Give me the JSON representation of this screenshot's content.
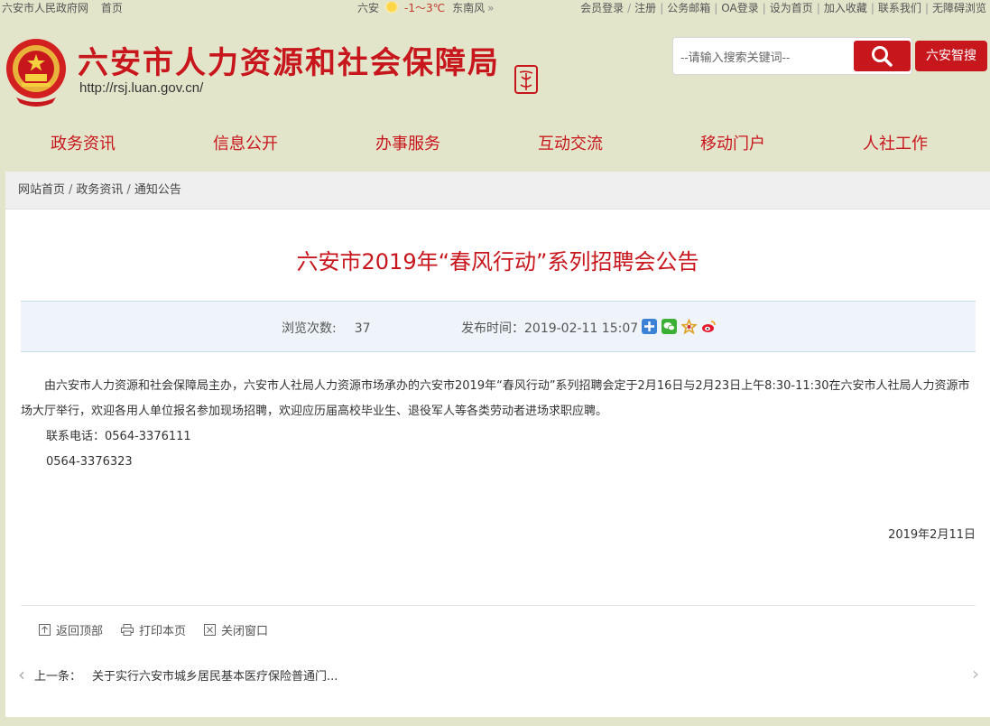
{
  "topbar": {
    "gov_site": "六安市人民政府网",
    "home": "首页",
    "city": "六安",
    "temp": "-1～3℃",
    "wind": "东南风",
    "chevron": "»",
    "links": [
      "会员登录",
      "注册",
      "公务邮箱",
      "OA登录",
      "设为首页",
      "加入收藏",
      "联系我们",
      "无障碍浏览"
    ]
  },
  "header": {
    "title": "六安市人力资源和社会保障局",
    "url": "http://rsj.luan.gov.cn/",
    "search_placeholder": "--请输入搜索关键词--",
    "smart_search": "六安智搜"
  },
  "nav": {
    "items": [
      "政务资讯",
      "信息公开",
      "办事服务",
      "互动交流",
      "移动门户",
      "人社工作"
    ]
  },
  "breadcrumb": {
    "items": [
      "网站首页",
      "政务资讯",
      "通知公告"
    ],
    "separator": "/"
  },
  "article": {
    "title": "六安市2019年“春风行动”系列招聘会公告",
    "views_label": "浏览次数:",
    "views": "37",
    "date_label": "发布时间：",
    "date": "2019-02-11 15:07",
    "paragraph": "由六安市人力资源和社会保障局主办，六安市人社局人力资源市场承办的六安市2019年“春风行动”系列招聘会定于2月16日与2月23日上午8:30-11:30在六安市人社局人力资源市场大厅举行，欢迎各用人单位报名参加现场招聘，欢迎应历届高校毕业生、退役军人等各类劳动者进场求职应聘。",
    "contact_label": "联系电话：",
    "phone1": "0564-3376111",
    "phone2": "0564-3376323",
    "sign_date": "2019年2月11日"
  },
  "tools": {
    "back_top": "返回顶部",
    "print": "打印本页",
    "close": "关闭窗口"
  },
  "pager": {
    "prev_label": "上一条：",
    "prev_title": "关于实行六安市城乡居民基本医疗保险普通门..."
  },
  "colors": {
    "brand_red": "#c8161d",
    "background": "#e3e5cb",
    "info_bar": "#eef4fa"
  }
}
